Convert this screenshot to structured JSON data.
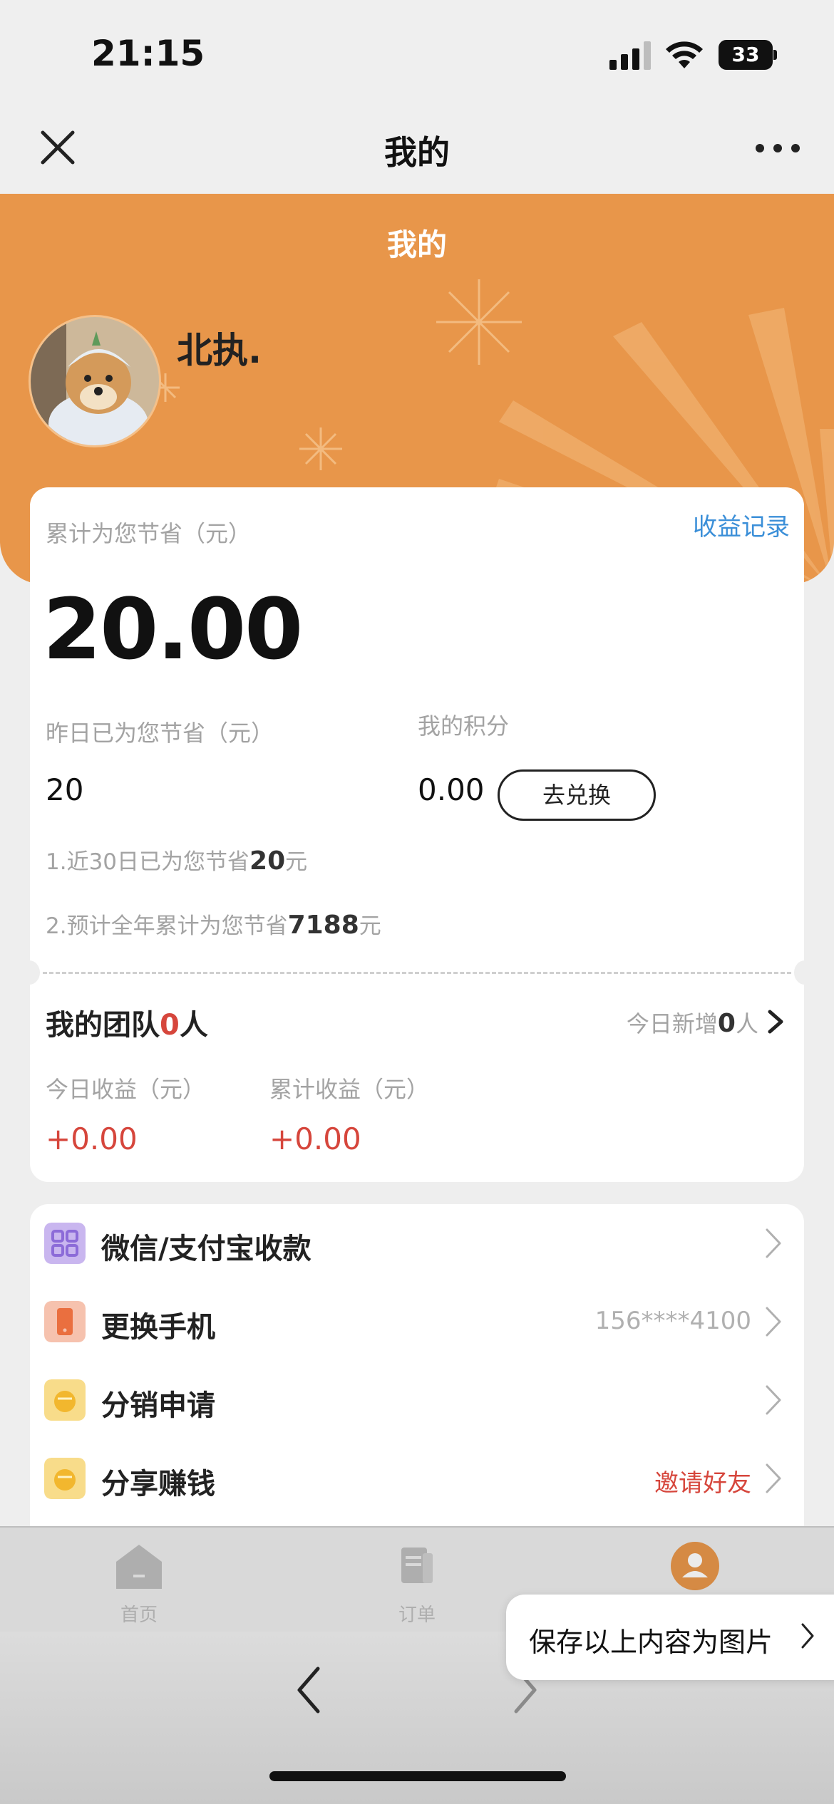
{
  "status_bar": {
    "time": "21:15",
    "battery": "33"
  },
  "nav": {
    "title": "我的",
    "close_icon": "close-icon",
    "more_icon": "more-icon"
  },
  "header": {
    "title": "我的",
    "username": "北执.",
    "avatar_icon": "avatar-icon"
  },
  "savings": {
    "label": "累计为您节省（元）",
    "income_link": "收益记录",
    "amount": "20.00",
    "yesterday_label": "昨日已为您节省（元）",
    "yesterday_value": "20",
    "points_label": "我的积分",
    "points_value": "0.00",
    "redeem_button": "去兑换",
    "note1_prefix": "1.近30日已为您节省",
    "note1_value": "20",
    "note1_suffix": "元",
    "note2_prefix": "2.预计全年累计为您节省",
    "note2_value": "7188",
    "note2_suffix": "元"
  },
  "team": {
    "title_prefix": "我的团队",
    "count": "0",
    "title_suffix": "人",
    "new_prefix": "今日新增",
    "new_count": "0",
    "new_suffix": "人",
    "today_income_label": "今日收益（元）",
    "today_income_value": "+0.00",
    "total_income_label": "累计收益（元）",
    "total_income_value": "+0.00"
  },
  "menu": {
    "items": [
      {
        "label": "微信/支付宝收款",
        "value": "",
        "icon": "qrcode-icon",
        "icon_color": "#c9b6ef"
      },
      {
        "label": "更换手机",
        "value": "156****4100",
        "icon": "phone-icon",
        "icon_color": "#f6c2ae"
      },
      {
        "label": "分销申请",
        "value": "",
        "icon": "coin-icon",
        "icon_color": "#f8dc8a"
      },
      {
        "label": "分享赚钱",
        "value": "邀请好友",
        "icon": "coin-icon",
        "icon_color": "#f8dc8a"
      }
    ]
  },
  "tabbar": {
    "items": [
      {
        "label": "首页",
        "icon": "home-icon"
      },
      {
        "label": "订单",
        "icon": "order-icon"
      },
      {
        "label": "",
        "icon": "profile-icon"
      }
    ],
    "active_color": "#e8964a"
  },
  "popover": {
    "label": "保存以上内容为图片"
  },
  "colors": {
    "accent": "#e8964a",
    "link": "#3b8fd8",
    "red": "#d6463c"
  }
}
